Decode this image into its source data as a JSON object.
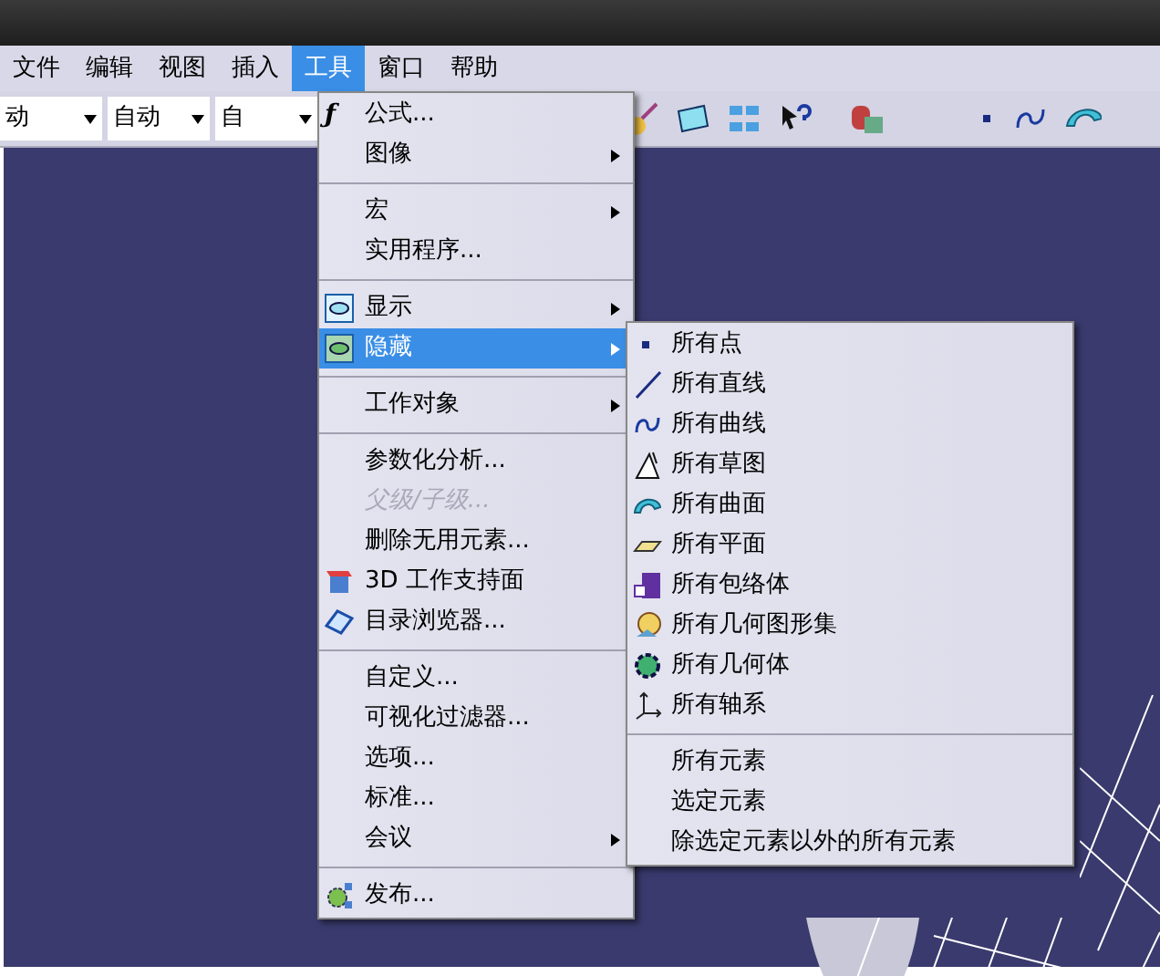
{
  "menu_bar": [
    {
      "label": "文件",
      "selected": false
    },
    {
      "label": "编辑",
      "selected": false
    },
    {
      "label": "视图",
      "selected": false
    },
    {
      "label": "插入",
      "selected": false
    },
    {
      "label": "工具",
      "selected": true
    },
    {
      "label": "窗口",
      "selected": false
    },
    {
      "label": "帮助",
      "selected": false
    }
  ],
  "toolbar": {
    "dropdowns": [
      "动",
      "自动",
      "自"
    ]
  },
  "tools_menu": [
    {
      "kind": "item",
      "glyph": "ƒ",
      "label": "公式...",
      "submenu": false,
      "disabled": false,
      "selected": false
    },
    {
      "kind": "item",
      "label": "图像",
      "submenu": true,
      "disabled": false,
      "selected": false
    },
    {
      "kind": "separator"
    },
    {
      "kind": "item",
      "label": "宏",
      "submenu": true,
      "disabled": false,
      "selected": false
    },
    {
      "kind": "item",
      "label": "实用程序...",
      "submenu": false,
      "disabled": false,
      "selected": false
    },
    {
      "kind": "separator"
    },
    {
      "kind": "item",
      "label": "显示",
      "submenu": true,
      "disabled": false,
      "selected": false
    },
    {
      "kind": "item",
      "label": "隐藏",
      "submenu": true,
      "disabled": false,
      "selected": true
    },
    {
      "kind": "separator"
    },
    {
      "kind": "item",
      "label": "工作对象",
      "submenu": true,
      "disabled": false,
      "selected": false
    },
    {
      "kind": "separator"
    },
    {
      "kind": "item",
      "label": "参数化分析...",
      "submenu": false,
      "disabled": false,
      "selected": false
    },
    {
      "kind": "item",
      "label": "父级/子级...",
      "submenu": false,
      "disabled": true,
      "selected": false
    },
    {
      "kind": "item",
      "label": "删除无用元素...",
      "submenu": false,
      "disabled": false,
      "selected": false
    },
    {
      "kind": "item",
      "label": "3D 工作支持面",
      "submenu": false,
      "disabled": false,
      "selected": false
    },
    {
      "kind": "item",
      "label": "目录浏览器...",
      "submenu": false,
      "disabled": false,
      "selected": false
    },
    {
      "kind": "separator"
    },
    {
      "kind": "item",
      "label": "自定义...",
      "submenu": false,
      "disabled": false,
      "selected": false
    },
    {
      "kind": "item",
      "label": "可视化过滤器...",
      "submenu": false,
      "disabled": false,
      "selected": false
    },
    {
      "kind": "item",
      "label": "选项...",
      "submenu": false,
      "disabled": false,
      "selected": false
    },
    {
      "kind": "item",
      "label": "标准...",
      "submenu": false,
      "disabled": false,
      "selected": false
    },
    {
      "kind": "item",
      "label": "会议",
      "submenu": true,
      "disabled": false,
      "selected": false
    },
    {
      "kind": "separator"
    },
    {
      "kind": "item",
      "label": "发布...",
      "submenu": false,
      "disabled": false,
      "selected": false
    }
  ],
  "hide_submenu": [
    {
      "kind": "item",
      "label": "所有点"
    },
    {
      "kind": "item",
      "label": "所有直线"
    },
    {
      "kind": "item",
      "label": "所有曲线"
    },
    {
      "kind": "item",
      "label": "所有草图"
    },
    {
      "kind": "item",
      "label": "所有曲面"
    },
    {
      "kind": "item",
      "label": "所有平面"
    },
    {
      "kind": "item",
      "label": "所有包络体"
    },
    {
      "kind": "item",
      "label": "所有几何图形集"
    },
    {
      "kind": "item",
      "label": "所有几何体"
    },
    {
      "kind": "item",
      "label": "所有轴系"
    },
    {
      "kind": "separator"
    },
    {
      "kind": "item",
      "label": "所有元素"
    },
    {
      "kind": "item",
      "label": "选定元素"
    },
    {
      "kind": "item",
      "label": "除选定元素以外的所有元素"
    }
  ]
}
